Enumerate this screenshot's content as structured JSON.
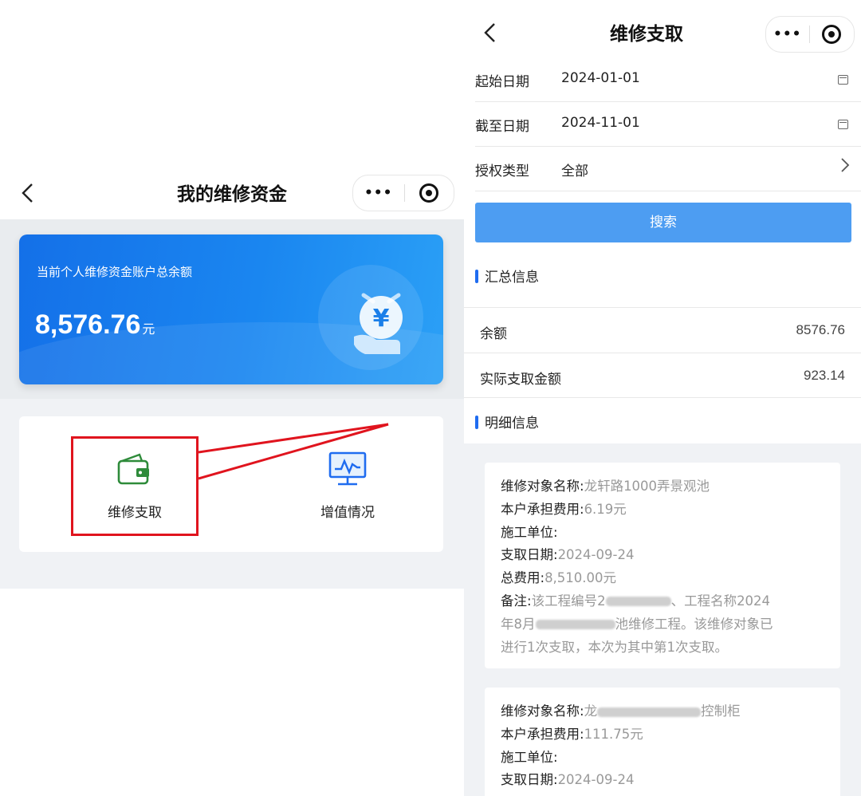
{
  "left": {
    "title": "我的维修资金",
    "back_icon": "chevron-left",
    "capsule": {
      "more": "•••"
    },
    "balance_card": {
      "label": "当前个人维修资金账户总余额",
      "amount": "8,576.76",
      "unit": "元",
      "icon": "coin-hand-yen-icon",
      "gradient": [
        "#1470e8",
        "#2ba0f6"
      ]
    },
    "menu": [
      {
        "label": "维修支取",
        "icon": "wallet-icon"
      },
      {
        "label": "增值情况",
        "icon": "monitor-chart-icon"
      }
    ],
    "highlight_color": "#e0141e"
  },
  "right": {
    "title": "维修支取",
    "capsule": {
      "more": "•••"
    },
    "filters": [
      {
        "label": "起始日期",
        "value": "2024-01-01",
        "icon": "calendar-icon"
      },
      {
        "label": "截至日期",
        "value": "2024-11-01",
        "icon": "calendar-icon"
      },
      {
        "label": "授权类型",
        "value": "全部",
        "icon": "chevron-right-icon"
      }
    ],
    "search_label": "搜索",
    "summary_title": "汇总信息",
    "summary": [
      {
        "label": "余额",
        "value": "8576.76"
      },
      {
        "label": "实际支取金额",
        "value": "923.14"
      }
    ],
    "detail_title": "明细信息",
    "details": [
      {
        "name_key": "维修对象名称:",
        "name_value": "龙轩路1000弄景观池",
        "share_key": "本户承担费用:",
        "share_value": "6.19元",
        "contractor_key": "施工单位:",
        "date_key": "支取日期:",
        "date_value": "2024-09-24",
        "total_key": "总费用:",
        "total_value": "8,510.00元",
        "note_key": "备注:",
        "note_a": "该工程编号2",
        "note_b": "、工程名称2024",
        "note_c": "年8月",
        "note_d": "池维修工程。该维修对象已",
        "note_e": "进行1次支取，本次为其中第1次支取。"
      },
      {
        "name_key": "维修对象名称:",
        "name_a": "龙",
        "name_b": "控制柜",
        "share_key": "本户承担费用:",
        "share_value": "111.75元",
        "contractor_key": "施工单位:",
        "date_key": "支取日期:",
        "date_value": "2024-09-24"
      }
    ],
    "accent": "#4d9df2"
  }
}
